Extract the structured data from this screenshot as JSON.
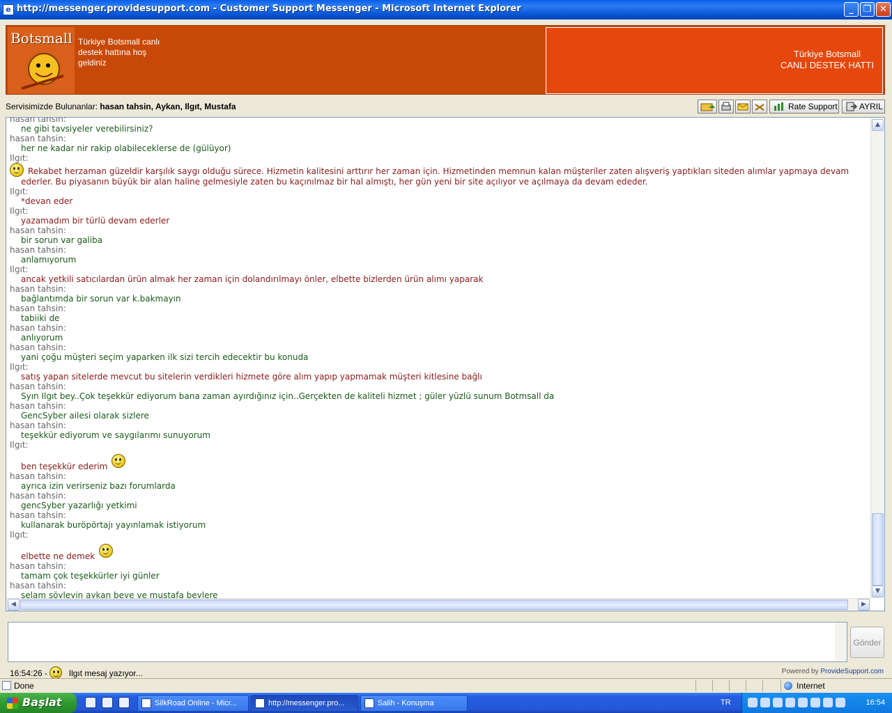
{
  "window": {
    "title": "http://messenger.providesupport.com - Customer Support Messenger - Microsoft Internet Explorer",
    "minimize": "_",
    "maximize": "❐",
    "close": "✕"
  },
  "banner": {
    "logo_text": "Botsmall",
    "welcome": "Türkiye Botsmall canlı destek hattına hoş geldiniz",
    "right_line1": "Türkiye Botsmall",
    "right_line2": "CANLI DESTEK HATTI"
  },
  "operators": {
    "label": "Servisimizde Bulunanlar:",
    "names": "hasan tahsin, Aykan, Ilgıt, Mustafa"
  },
  "toolbar": {
    "rate_label": "Rate Support",
    "leave_label": "AYRIL"
  },
  "messages": [
    {
      "who": "hasan tahsin:",
      "text": "ne gibi tavsiyeler verebilirsiniz?",
      "role": "cl"
    },
    {
      "who": "hasan tahsin:",
      "text": "her ne kadar nir rakip olabileceklerse de (gülüyor)",
      "role": "cl"
    },
    {
      "who": "Ilgıt:",
      "text": "Rekabet herzaman güzeldir karşılık saygı olduğu sürece. Hizmetin kalitesini arttırır her zaman için. Hizmetinden memnun kalan müşteriler zaten alışveriş yaptıkları siteden alımlar yapmaya devam ederler. Bu piyasanın büyük bir alan haline gelmesiyle zaten bu kaçınılmaz bir hal almıştı, her gün yeni bir site açılıyor ve açılmaya da devam ededer.",
      "role": "op"
    },
    {
      "who": "Ilgıt:",
      "text": "*devan eder",
      "role": "op"
    },
    {
      "who": "Ilgıt:",
      "text": "yazamadım bir türlü devam ederler",
      "role": "op"
    },
    {
      "who": "hasan tahsin:",
      "text": "bir sorun var galiba",
      "role": "cl"
    },
    {
      "who": "hasan tahsin:",
      "text": "anlamıyorum",
      "role": "cl"
    },
    {
      "who": "Ilgıt:",
      "text": "ancak yetkili satıcılardan ürün almak her zaman için dolandırılmayı önler, elbette bizlerden ürün alımı yaparak",
      "role": "op"
    },
    {
      "who": "hasan tahsin:",
      "text": "bağlantımda bir sorun var k.bakmayın",
      "role": "cl"
    },
    {
      "who": "hasan tahsin:",
      "text": "tabiiki de",
      "role": "cl"
    },
    {
      "who": "hasan tahsin:",
      "text": "anlıyorum",
      "role": "cl"
    },
    {
      "who": "hasan tahsin:",
      "text": "yani çoğu müşteri seçim yaparken ilk sizi tercih edecektir bu konuda",
      "role": "cl"
    },
    {
      "who": "Ilgıt:",
      "text": "satış yapan sitelerde mevcut bu sitelerin verdikleri hizmete göre alım yapıp yapmamak müşteri kitlesine bağlı",
      "role": "op"
    },
    {
      "who": "hasan tahsin:",
      "text": "Syın Ilgıt bey..Çok teşekkür ediyorum bana zaman ayırdığınız için..Gerçekten de kaliteli hizmet ; güler yüzlü sunum Botmsall da",
      "role": "cl"
    },
    {
      "who": "hasan tahsin:",
      "text": "GencSyber ailesi olarak sizlere",
      "role": "cl"
    },
    {
      "who": "hasan tahsin:",
      "text": "teşekkür ediyorum ve saygılarımı sunuyorum",
      "role": "cl"
    },
    {
      "who": "Ilgıt:",
      "text": "ben teşekkür ederim",
      "role": "op"
    },
    {
      "who": "hasan tahsin:",
      "text": "ayrıca izin verirseniz bazı forumlarda",
      "role": "cl"
    },
    {
      "who": "hasan tahsin:",
      "text": "gencSyber yazarlığı yetkimi",
      "role": "cl"
    },
    {
      "who": "hasan tahsin:",
      "text": "kullanarak buröpörtajı yayınlamak istiyorum",
      "role": "cl"
    },
    {
      "who": "Ilgıt:",
      "text": "elbette ne demek",
      "role": "op"
    },
    {
      "who": "hasan tahsin:",
      "text": "tamam çok teşekkürler iyi günler",
      "role": "cl"
    },
    {
      "who": "hasan tahsin:",
      "text": "selam söyleyin aykan beye ve mustafa beylere",
      "role": "cl"
    }
  ],
  "send_button": "Gönder",
  "status": {
    "time": "16:54:26 -",
    "typing": "Ilgıt mesaj yazıyor..."
  },
  "powered": {
    "prefix": "Powered by",
    "link": "ProvideSupport.com"
  },
  "ie_status": {
    "done": "Done",
    "zone": "Internet"
  },
  "taskbar": {
    "start": "Başlat",
    "tasks": [
      "SilkRoad Online - Micr...",
      "http://messenger.pro...",
      "Salih - Konuşma"
    ],
    "lang": "TR",
    "clock": "16:54"
  }
}
